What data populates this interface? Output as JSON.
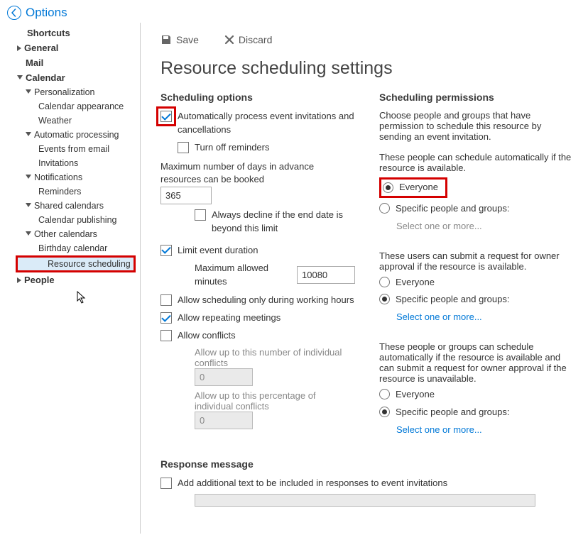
{
  "header": {
    "options": "Options"
  },
  "sidebar": {
    "shortcuts": "Shortcuts",
    "general": "General",
    "mail": "Mail",
    "calendar": "Calendar",
    "personalization": "Personalization",
    "calendar_appearance": "Calendar appearance",
    "weather": "Weather",
    "automatic_processing": "Automatic processing",
    "events_from_email": "Events from email",
    "invitations": "Invitations",
    "notifications": "Notifications",
    "reminders": "Reminders",
    "shared_calendars": "Shared calendars",
    "calendar_publishing": "Calendar publishing",
    "other_calendars": "Other calendars",
    "birthday_calendar": "Birthday calendar",
    "resource_scheduling": "Resource scheduling",
    "people": "People"
  },
  "toolbar": {
    "save": "Save",
    "discard": "Discard"
  },
  "page": {
    "title": "Resource scheduling settings"
  },
  "sched_opts": {
    "heading": "Scheduling options",
    "auto_process": "Automatically process event invitations and cancellations",
    "turn_off_reminders": "Turn off reminders",
    "max_days_label": "Maximum number of days in advance resources can be booked",
    "max_days_value": "365",
    "always_decline": "Always decline if the end date is beyond this limit",
    "limit_duration": "Limit event duration",
    "max_minutes_label": "Maximum allowed minutes",
    "max_minutes_value": "10080",
    "working_hours": "Allow scheduling only during working hours",
    "allow_repeating": "Allow repeating meetings",
    "allow_conflicts": "Allow conflicts",
    "up_to_individual": "Allow up to this number of individual conflicts",
    "individual_value": "0",
    "up_to_percentage": "Allow up to this percentage of individual conflicts",
    "percentage_value": "0"
  },
  "sched_perms": {
    "heading": "Scheduling permissions",
    "intro": "Choose people and groups that have permission to schedule this resource by sending an event invitation.",
    "auto_label": "These people can schedule automatically if the resource is available.",
    "everyone": "Everyone",
    "specific": "Specific people and groups:",
    "select_more": "Select one or more...",
    "submit_label": "These users can submit a request for owner approval if the resource is available.",
    "combo_label": "These people or groups can schedule automatically if the resource is available and can submit a request for owner approval if the resource is unavailable."
  },
  "response": {
    "heading": "Response message",
    "add_text": "Add additional text to be included in responses to event invitations",
    "body": ""
  }
}
